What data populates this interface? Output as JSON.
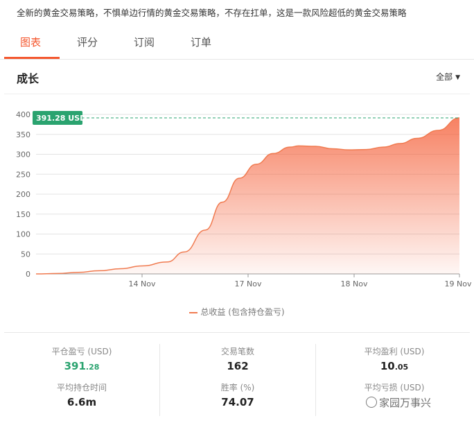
{
  "description": "全新的黄金交易策略，不惧单边行情的黄金交易策略，不存在扛单，这是一款风险超低的黄金交易策略",
  "tabs": [
    {
      "label": "图表",
      "active": true
    },
    {
      "label": "评分",
      "active": false
    },
    {
      "label": "订阅",
      "active": false
    },
    {
      "label": "订单",
      "active": false
    }
  ],
  "section": {
    "title": "成长",
    "range_label": "全部"
  },
  "colors": {
    "accent": "#f4572e",
    "line": "#f07a4f",
    "badge": "#2aa36f",
    "positive": "#2aa36f"
  },
  "chart_data": {
    "type": "area",
    "ylim": [
      0,
      400
    ],
    "yticks": [
      0,
      50,
      100,
      150,
      200,
      250,
      300,
      350,
      400
    ],
    "xtick_labels": [
      "14 Nov",
      "17 Nov",
      "18 Nov",
      "19 Nov"
    ],
    "current_value_label": "391.28 USD",
    "current_value": 391.28,
    "grid": true,
    "series": [
      {
        "name": "总收益 (包含持仓盈亏)",
        "points": [
          {
            "x": 0,
            "y": 0
          },
          {
            "x": 0.05,
            "y": 1
          },
          {
            "x": 0.1,
            "y": 4
          },
          {
            "x": 0.15,
            "y": 8
          },
          {
            "x": 0.2,
            "y": 13
          },
          {
            "x": 0.25,
            "y": 20
          },
          {
            "x": 0.31,
            "y": 30
          },
          {
            "x": 0.35,
            "y": 55
          },
          {
            "x": 0.4,
            "y": 110
          },
          {
            "x": 0.44,
            "y": 180
          },
          {
            "x": 0.48,
            "y": 240
          },
          {
            "x": 0.52,
            "y": 275
          },
          {
            "x": 0.56,
            "y": 302
          },
          {
            "x": 0.6,
            "y": 318
          },
          {
            "x": 0.62,
            "y": 321
          },
          {
            "x": 0.66,
            "y": 320
          },
          {
            "x": 0.7,
            "y": 314
          },
          {
            "x": 0.74,
            "y": 311
          },
          {
            "x": 0.78,
            "y": 312
          },
          {
            "x": 0.82,
            "y": 318
          },
          {
            "x": 0.86,
            "y": 327
          },
          {
            "x": 0.9,
            "y": 340
          },
          {
            "x": 0.95,
            "y": 360
          },
          {
            "x": 1,
            "y": 391.28
          }
        ]
      }
    ]
  },
  "legend": {
    "label": "总收益 (包含持仓盈亏)"
  },
  "stats": [
    {
      "label": "平仓盈亏 (USD)",
      "value_main": "391",
      "value_small": ".28",
      "positive": true
    },
    {
      "label": "交易笔数",
      "value_main": "162",
      "value_small": "",
      "positive": false
    },
    {
      "label": "平均盈利 (USD)",
      "value_main": "10",
      "value_small": ".05",
      "positive": false
    },
    {
      "label": "平均持仓时间",
      "value_main": "6.6m",
      "value_small": "",
      "positive": false
    },
    {
      "label": "胜率 (%)",
      "value_main": "74.07",
      "value_small": "",
      "positive": false
    },
    {
      "label": "平均亏损 (USD)",
      "value_main": "",
      "value_small": "",
      "positive": false
    }
  ],
  "watermark": {
    "text": "家园万事兴"
  }
}
